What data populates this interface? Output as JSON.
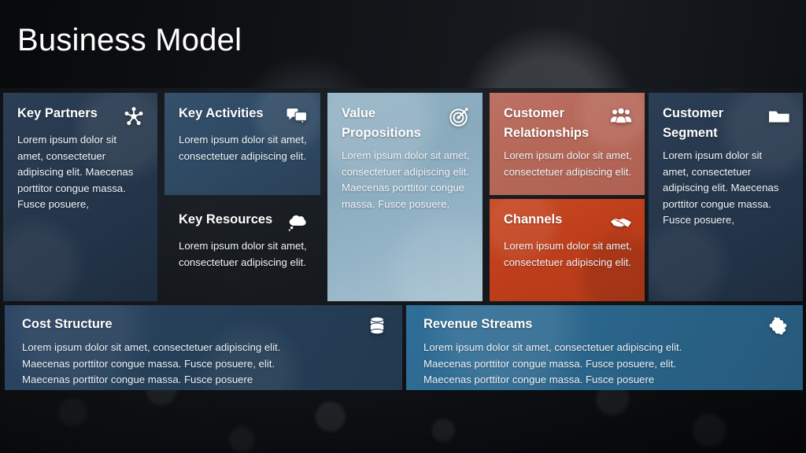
{
  "header": {
    "title": "Business Model",
    "ghost": ""
  },
  "colors": {
    "navy": "#27384d",
    "steel": "#2f4a64",
    "blue": "#356f9b",
    "pale": "#8aaabd",
    "rose": "#b56858",
    "red": "#bf3e1b",
    "bar_dark": "#264059",
    "bar_blue": "#2a6489",
    "header_bg": "#121418",
    "text": "#ffffff"
  },
  "cards": {
    "key_partners": {
      "title": "Key Partners",
      "icon": "network-hub-icon",
      "body": "Lorem ipsum dolor sit amet, consectetuer adipiscing elit. Maecenas porttitor congue massa. Fusce posuere,"
    },
    "key_activities": {
      "title": "Key Activities",
      "icon": "speech-bubbles-icon",
      "body": "Lorem ipsum dolor sit amet, consectetuer adipiscing elit."
    },
    "key_resources": {
      "title": "Key Resources",
      "icon": "thought-cloud-icon",
      "body": "Lorem ipsum dolor sit amet, consectetuer adipiscing elit."
    },
    "value_propositions": {
      "title": "Value Propositions",
      "icon": "target-bullseye-icon",
      "body": "Lorem ipsum dolor sit amet, consectetuer adipiscing elit. Maecenas porttitor congue massa. Fusce posuere,"
    },
    "customer_relationships": {
      "title": "Customer Relationships",
      "icon": "people-group-icon",
      "body": "Lorem ipsum dolor sit amet, consectetuer adipiscing elit."
    },
    "channels": {
      "title": "Channels",
      "icon": "handshake-icon",
      "body": "Lorem ipsum dolor sit amet, consectetuer adipiscing elit."
    },
    "customer_segment": {
      "title": "Customer Segment",
      "icon": "folder-icon",
      "body": "Lorem ipsum dolor sit amet, consectetuer adipiscing elit. Maecenas porttitor congue massa. Fusce posuere,"
    },
    "cost_structure": {
      "title": "Cost Structure",
      "icon": "database-stack-icon",
      "line1": "Lorem ipsum dolor sit amet, consectetuer  adipiscing elit.",
      "line2": "Maecenas porttitor congue massa. Fusce posuere, elit.",
      "line3": "Maecenas porttitor congue massa. Fusce posuere"
    },
    "revenue_streams": {
      "title": "Revenue Streams",
      "icon": "puzzle-piece-icon",
      "line1": "Lorem ipsum dolor sit amet, consectetuer  adipiscing elit.",
      "line2": "Maecenas porttitor congue massa. Fusce posuere, elit.",
      "line3": "Maecenas porttitor congue massa. Fusce posuere"
    }
  }
}
